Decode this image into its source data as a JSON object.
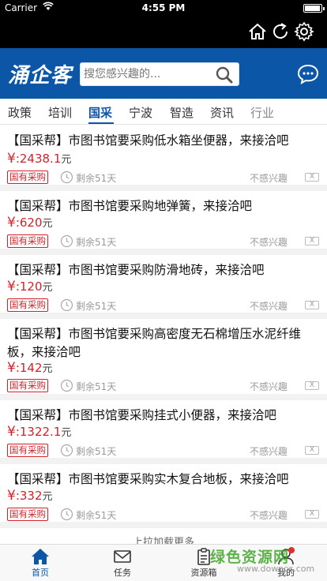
{
  "status_bar": {
    "carrier": "Carrier",
    "time": "4:55 PM"
  },
  "header": {
    "logo": "涌企客",
    "search_placeholder": "搜您感兴趣的..."
  },
  "tabs": [
    {
      "label": "政策",
      "state": "normal"
    },
    {
      "label": "培训",
      "state": "normal"
    },
    {
      "label": "国采",
      "state": "active"
    },
    {
      "label": "宁波",
      "state": "normal"
    },
    {
      "label": "智造",
      "state": "normal"
    },
    {
      "label": "资讯",
      "state": "normal"
    },
    {
      "label": "行业",
      "state": "dim"
    }
  ],
  "items": [
    {
      "title": "【国采帮】市图书馆要采购低水箱坐便器，来接洽吧",
      "currency": "¥",
      "price": ":2438.1",
      "unit": "元",
      "badge": "国有采购",
      "remaining": "剩余51天",
      "not_interested": "不感兴趣"
    },
    {
      "title": "【国采帮】市图书馆要采购地弹簧，来接洽吧",
      "currency": "¥",
      "price": ":620",
      "unit": "元",
      "badge": "国有采购",
      "remaining": "剩余51天",
      "not_interested": "不感兴趣"
    },
    {
      "title": "【国采帮】市图书馆要采购防滑地砖，来接洽吧",
      "currency": "¥",
      "price": ":120",
      "unit": "元",
      "badge": "国有采购",
      "remaining": "剩余51天",
      "not_interested": "不感兴趣"
    },
    {
      "title": "【国采帮】市图书馆要采购高密度无石棉增压水泥纤维板，来接洽吧",
      "currency": "¥",
      "price": ":142",
      "unit": "元",
      "badge": "国有采购",
      "remaining": "剩余51天",
      "not_interested": "不感兴趣"
    },
    {
      "title": "【国采帮】市图书馆要采购挂式小便器，来接洽吧",
      "currency": "¥",
      "price": ":1322.1",
      "unit": "元",
      "badge": "国有采购",
      "remaining": "剩余51天",
      "not_interested": "不感兴趣"
    },
    {
      "title": "【国采帮】市图书馆要采购实木复合地板，来接洽吧",
      "currency": "¥",
      "price": ":332",
      "unit": "元",
      "badge": "国有采购",
      "remaining": "剩余51天",
      "not_interested": "不感兴趣"
    }
  ],
  "close_mark": "X",
  "load_more": "上拉加载更多",
  "bottom_tabs": [
    {
      "label": "首页",
      "icon": "home-icon",
      "active": true
    },
    {
      "label": "任务",
      "icon": "envelope-icon",
      "active": false
    },
    {
      "label": "资源箱",
      "icon": "clipboard-icon",
      "active": false
    },
    {
      "label": "我的",
      "icon": "user-icon",
      "active": false
    }
  ],
  "watermark": {
    "cn": "绿色资源网",
    "en": "www.downcc.com"
  },
  "colors": {
    "brand_blue": "#0c56a8",
    "price_red": "#d2232a",
    "watermark_green": "#43a72c"
  }
}
